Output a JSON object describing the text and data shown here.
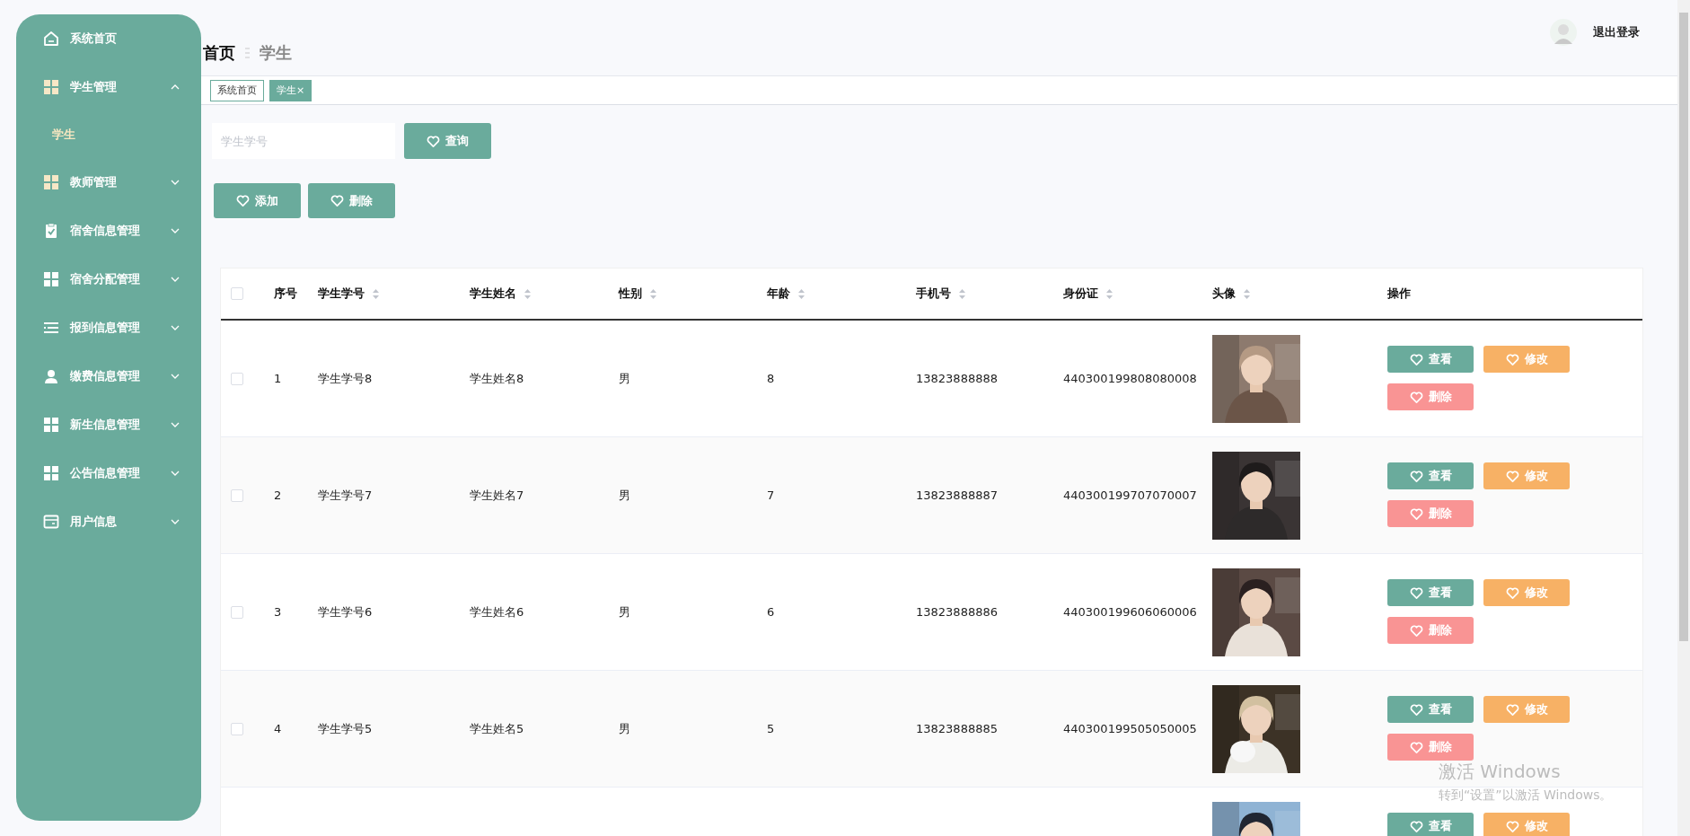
{
  "sidebar": {
    "items": [
      {
        "label": "系统首页",
        "expandable": false
      },
      {
        "label": "学生管理",
        "expandable": true,
        "expanded": true,
        "children": [
          {
            "label": "学生",
            "selected": true
          }
        ]
      },
      {
        "label": "教师管理",
        "expandable": true,
        "expanded": false
      },
      {
        "label": "宿舍信息管理",
        "expandable": true,
        "expanded": false
      },
      {
        "label": "宿舍分配管理",
        "expandable": true,
        "expanded": false
      },
      {
        "label": "报到信息管理",
        "expandable": true,
        "expanded": false
      },
      {
        "label": "缴费信息管理",
        "expandable": true,
        "expanded": false
      },
      {
        "label": "新生信息管理",
        "expandable": true,
        "expanded": false
      },
      {
        "label": "公告信息管理",
        "expandable": true,
        "expanded": false
      },
      {
        "label": "用户信息",
        "expandable": true,
        "expanded": false
      }
    ]
  },
  "breadcrumb": {
    "root": "首页",
    "current": "学生"
  },
  "user": {
    "logout": "退出登录"
  },
  "tabs": [
    {
      "label": "系统首页",
      "selected": false
    },
    {
      "label": "学生",
      "selected": true,
      "close": "×"
    }
  ],
  "search": {
    "placeholder": "学生学号",
    "button": "查询"
  },
  "toolbar": [
    "添加",
    "删除"
  ],
  "table": {
    "select_all": {
      "checked": false
    },
    "columns": [
      {
        "label": "序号",
        "sortable": false
      },
      {
        "label": "学生学号",
        "sortable": true
      },
      {
        "label": "学生姓名",
        "sortable": true
      },
      {
        "label": "性别",
        "sortable": true
      },
      {
        "label": "年龄",
        "sortable": true
      },
      {
        "label": "手机号",
        "sortable": true
      },
      {
        "label": "身份证",
        "sortable": true
      },
      {
        "label": "头像",
        "sortable": true
      },
      {
        "label": "操作",
        "sortable": false
      }
    ],
    "rows": [
      {
        "checked": false,
        "cells": [
          "1",
          "学生学号8",
          "学生姓名8",
          "男",
          "8",
          "13823888888",
          "440300199808080008"
        ],
        "avatar": {
          "kind": "picture"
        },
        "actions": [
          {
            "label": "查看",
            "kind": "view"
          },
          {
            "label": "修改",
            "kind": "edit"
          },
          {
            "label": "删除",
            "kind": "delete"
          }
        ]
      },
      {
        "checked": false,
        "cells": [
          "2",
          "学生学号7",
          "学生姓名7",
          "男",
          "7",
          "13823888887",
          "440300199707070007"
        ],
        "avatar": {
          "kind": "picture"
        },
        "actions": [
          {
            "label": "查看",
            "kind": "view"
          },
          {
            "label": "修改",
            "kind": "edit"
          },
          {
            "label": "删除",
            "kind": "delete"
          }
        ]
      },
      {
        "checked": false,
        "cells": [
          "3",
          "学生学号6",
          "学生姓名6",
          "男",
          "6",
          "13823888886",
          "440300199606060006"
        ],
        "avatar": {
          "kind": "picture"
        },
        "actions": [
          {
            "label": "查看",
            "kind": "view"
          },
          {
            "label": "修改",
            "kind": "edit"
          },
          {
            "label": "删除",
            "kind": "delete"
          }
        ]
      },
      {
        "checked": false,
        "cells": [
          "4",
          "学生学号5",
          "学生姓名5",
          "男",
          "5",
          "13823888885",
          "440300199505050005"
        ],
        "avatar": {
          "kind": "picture"
        },
        "actions": [
          {
            "label": "查看",
            "kind": "view"
          },
          {
            "label": "修改",
            "kind": "edit"
          },
          {
            "label": "删除",
            "kind": "delete"
          }
        ]
      },
      {
        "avatar": {
          "kind": "picture"
        },
        "actions": [
          {
            "label": "查看",
            "kind": "view"
          },
          {
            "label": "修改",
            "kind": "edit"
          }
        ]
      }
    ]
  },
  "os_notice": {
    "title": "激活 Windows",
    "text": "转到“设置”以激活 Windows。"
  }
}
